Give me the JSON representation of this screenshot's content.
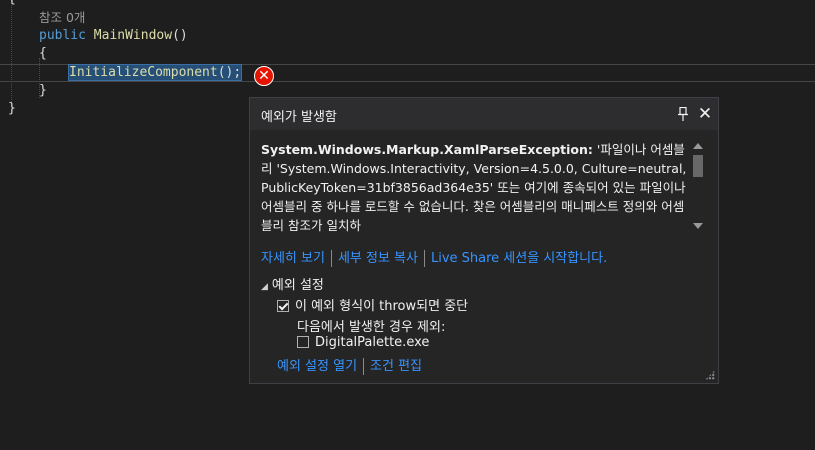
{
  "editor": {
    "line_top": "{",
    "refs": "참조 0개",
    "ctor_keyword": "public",
    "ctor_name": "MainWindow",
    "ctor_parens": "()",
    "open_brace": "{",
    "call_name": "InitializeComponent",
    "call_suffix": "();",
    "close_brace": "}",
    "outer_close": "}"
  },
  "exception_popup": {
    "title": "예외가 발생함",
    "pin_icon": "pin-icon",
    "close_icon": "close-icon",
    "exception_type": "System.Windows.Markup.XamlParseException:",
    "message": "'파일이나 어셈블리 'System.Windows.Interactivity, Version=4.5.0.0, Culture=neutral, PublicKeyToken=31bf3856ad364e35' 또는 여기에 종속되어 있는 파일이나 어셈블리 중 하나를 로드할 수 없습니다. 찾은 어셈블리의 매니페스트 정의와 어셈블리 참조가 일치하",
    "links": {
      "view_details": "자세히 보기",
      "copy_details": "세부 정보 복사",
      "live_share": "Live Share 세션을 시작합니다."
    },
    "settings": {
      "header": "예외 설정",
      "break_when_thrown": "이 예외 형식이 throw되면 중단",
      "break_when_thrown_checked": true,
      "except_when_from": "다음에서 발생한 경우 제외:",
      "module": "DigitalPalette.exe",
      "module_checked": false
    },
    "bottom_links": {
      "open_settings": "예외 설정 열기",
      "edit_conditions": "조건 편집"
    }
  },
  "colors": {
    "editor_bg": "#1e1e1e",
    "popup_bg": "#252526",
    "link": "#3794ff",
    "error": "#e51400",
    "keyword": "#569cd6",
    "method": "#dcdcaa",
    "selection": "#264f78"
  }
}
